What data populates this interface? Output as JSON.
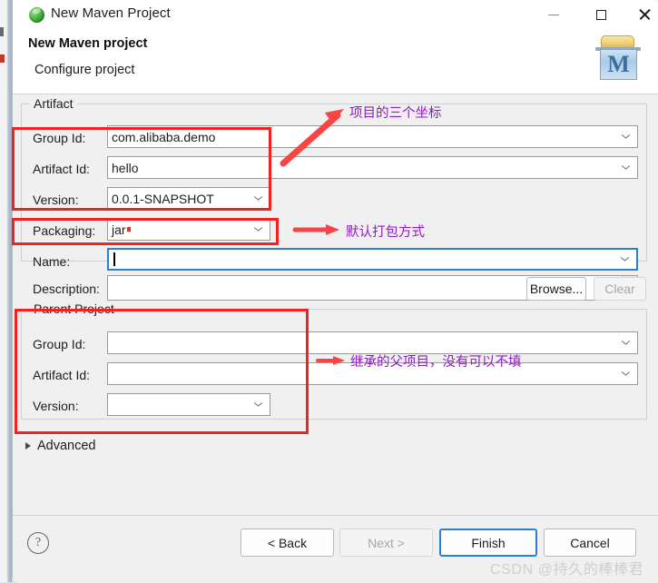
{
  "window": {
    "title": "New Maven Project",
    "icon": "maven-green-ball-icon",
    "minimize_glyph": "minimize-icon",
    "maximize_glyph": "maximize-icon",
    "close_glyph": "close-icon"
  },
  "header": {
    "heading": "New Maven project",
    "subheading": "Configure project",
    "banner_icon_letter": "M",
    "banner_icon_name": "maven-folder-icon"
  },
  "artifact": {
    "group_title": "Artifact",
    "fields": [
      {
        "label": "Group Id:",
        "value": "com.alibaba.demo",
        "type": "combo",
        "focused": false
      },
      {
        "label": "Artifact Id:",
        "value": "hello",
        "type": "combo",
        "focused": false
      },
      {
        "label": "Version:",
        "value": "0.0.1-SNAPSHOT",
        "type": "combo",
        "focused": false
      },
      {
        "label": "Packaging:",
        "value": "jar",
        "type": "combo",
        "focused": false
      }
    ],
    "name": {
      "label": "Name:",
      "value": "",
      "focused": true
    },
    "description": {
      "label": "Description:",
      "value": ""
    }
  },
  "parent": {
    "group_title": "Parent Project",
    "fields": [
      {
        "label": "Group Id:",
        "value": "",
        "type": "combo"
      },
      {
        "label": "Artifact Id:",
        "value": "",
        "type": "combo"
      },
      {
        "label": "Version:",
        "value": "",
        "type": "combo"
      }
    ],
    "browse_label": "Browse...",
    "clear_label": "Clear",
    "clear_disabled": true
  },
  "advanced": {
    "label": "Advanced",
    "expanded": false
  },
  "footer": {
    "help_label": "?",
    "back_label": "< Back",
    "next_label": "Next >",
    "next_disabled": true,
    "finish_label": "Finish",
    "finish_default": true,
    "cancel_label": "Cancel"
  },
  "annotations": {
    "color_box": "#f42121",
    "color_text": "#8f1ac4",
    "coords_note": "项目的三个坐标",
    "packaging_note": "默认打包方式",
    "parent_note": "继承的父项目，没有可以不填"
  },
  "watermark": {
    "text": "CSDN @持久的棒棒君"
  }
}
